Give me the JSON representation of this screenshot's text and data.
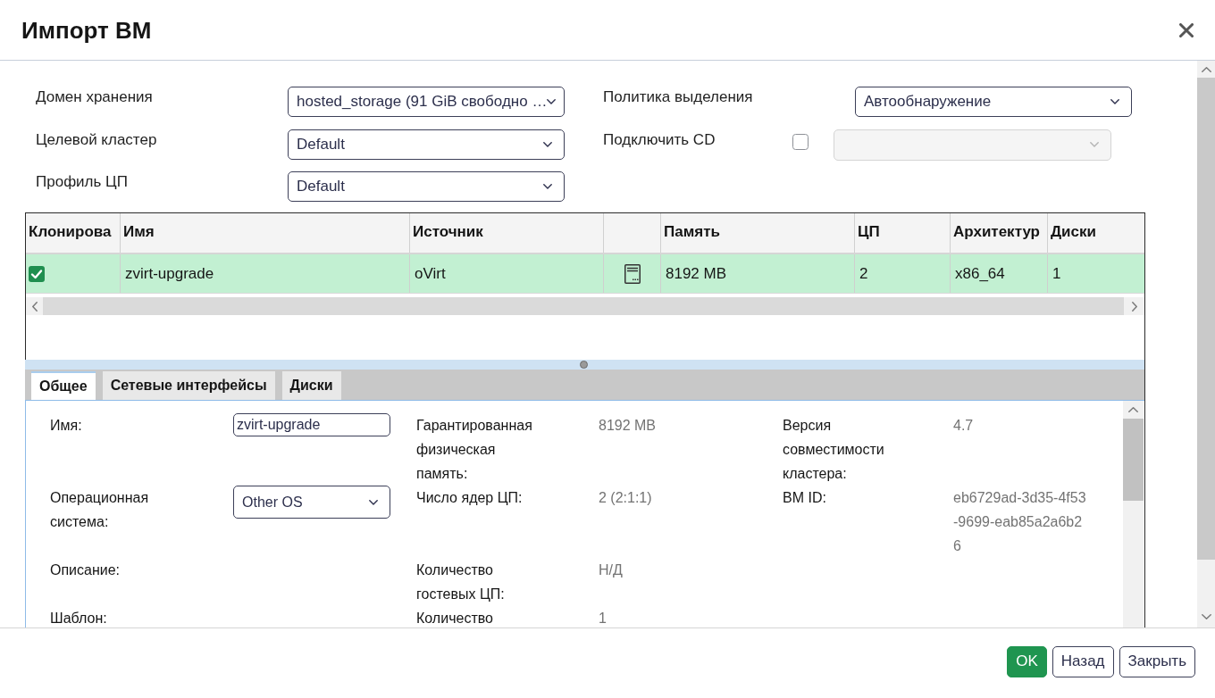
{
  "dialog": {
    "title": "Импорт ВМ"
  },
  "storage_form": {
    "left": [
      {
        "label": "Домен хранения",
        "kind": "select",
        "value": "hosted_storage (91 GiB свободно …"
      },
      {
        "label": "Целевой кластер",
        "kind": "select",
        "value": "Default"
      },
      {
        "label": "Профиль ЦП",
        "kind": "select",
        "value": "Default"
      }
    ],
    "right": [
      {
        "label": "Политика выделения",
        "kind": "select",
        "value": "Автообнаружение"
      },
      {
        "label": "Подключить CD",
        "kind": "checkbox_select",
        "checked": false,
        "disabled": true
      }
    ]
  },
  "table": {
    "columns": [
      {
        "kind": "text",
        "label": "Клонирова"
      },
      {
        "kind": "text",
        "label": "Имя"
      },
      {
        "kind": "text",
        "label": "Источник"
      },
      {
        "kind": "icon"
      },
      {
        "kind": "text",
        "label": "Память"
      },
      {
        "kind": "text",
        "label": "ЦП"
      },
      {
        "kind": "text",
        "label": "Архитектур"
      },
      {
        "kind": "text",
        "label": "Диски"
      }
    ],
    "rows": [
      {
        "selected": true,
        "cells": [
          {
            "kind": "checkbox",
            "checked": true
          },
          {
            "kind": "text",
            "text": "zvirt-upgrade"
          },
          {
            "kind": "text",
            "text": "oVirt"
          },
          {
            "kind": "icon"
          },
          {
            "kind": "text",
            "text": "8192 MB"
          },
          {
            "kind": "text",
            "text": "2"
          },
          {
            "kind": "text",
            "text": "x86_64"
          },
          {
            "kind": "text",
            "text": "1"
          }
        ]
      }
    ]
  },
  "tabs": [
    {
      "label": "Общее",
      "selected": true
    },
    {
      "label": "Сетевые интерфейсы",
      "selected": false
    },
    {
      "label": "Диски",
      "selected": false
    }
  ],
  "general": {
    "rows": [
      [
        {
          "label": "Имя:",
          "kind": "input",
          "value": "zvirt-upgrade"
        },
        {
          "label": "Гарантированная физическая память:",
          "kind": "text",
          "value": "8192 MB"
        },
        {
          "label": "Версия совместимости кластера:",
          "kind": "text",
          "value": "4.7"
        }
      ],
      [
        {
          "label": "Операционная система:",
          "kind": "select",
          "value": "Other OS"
        },
        {
          "label": "Число ядер ЦП:",
          "kind": "text",
          "value": "2 (2:1:1)"
        },
        {
          "label": "ВМ ID:",
          "kind": "text",
          "value": "eb6729ad-3d35-4f53-9699-eab85a2a6b26"
        }
      ],
      [
        {
          "label": "Описание:",
          "kind": "text"
        },
        {
          "label": "Количество гостевых ЦП:",
          "kind": "text",
          "value": "Н/Д"
        }
      ],
      [
        {
          "label": "Шаблон:",
          "kind": "text"
        },
        {
          "label": "Количество",
          "kind": "text",
          "value": "1"
        }
      ]
    ]
  },
  "footer": {
    "buttons": [
      {
        "label": "OK",
        "kind": "primary"
      },
      {
        "label": "Назад",
        "kind": "secondary"
      },
      {
        "label": "Закрыть",
        "kind": "secondary"
      }
    ]
  }
}
